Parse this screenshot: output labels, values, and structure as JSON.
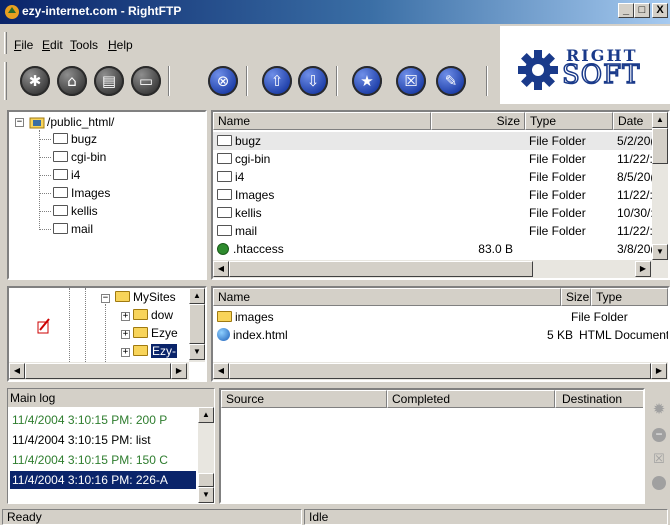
{
  "window": {
    "title": "ezy-internet.com - RightFTP",
    "min": "_",
    "max": "□",
    "close": "X"
  },
  "menu": [
    "File",
    "Edit",
    "Tools",
    "Help"
  ],
  "logo": {
    "line1": "RIGHT",
    "line2": "SOFT"
  },
  "toolbar": {
    "icons": [
      "connect-icon",
      "disconnect-icon",
      "site-manager-icon",
      "terminal-icon",
      "abort-icon",
      "upload-icon",
      "download-icon",
      "new-folder-icon",
      "properties-icon",
      "delete-icon"
    ]
  },
  "remote_tree": {
    "root": "/public_html/",
    "items": [
      "bugz",
      "cgi-bin",
      "i4",
      "Images",
      "kellis",
      "mail"
    ]
  },
  "remote_files": {
    "columns": [
      "Name",
      "Size",
      "Type",
      "Date"
    ],
    "rows": [
      {
        "name": "bugz",
        "size": "",
        "type": "File Folder",
        "date": "5/2/20("
      },
      {
        "name": "cgi-bin",
        "size": "",
        "type": "File Folder",
        "date": "11/22/:"
      },
      {
        "name": "i4",
        "size": "",
        "type": "File Folder",
        "date": "8/5/20("
      },
      {
        "name": "Images",
        "size": "",
        "type": "File Folder",
        "date": "11/22/:"
      },
      {
        "name": "kellis",
        "size": "",
        "type": "File Folder",
        "date": "10/30/:"
      },
      {
        "name": "mail",
        "size": "",
        "type": "File Folder",
        "date": "11/22/:"
      },
      {
        "name": ".htaccess",
        "size": "83.0 B",
        "type": "",
        "date": "3/8/20("
      }
    ]
  },
  "local_tree": {
    "items": [
      "MySites",
      "dow",
      "Ezye",
      "Ezy-"
    ]
  },
  "local_files": {
    "columns": [
      "Name",
      "Size",
      "Type"
    ],
    "rows": [
      {
        "name": "images",
        "size": "",
        "type": "File Folder"
      },
      {
        "name": "index.html",
        "size": "5 KB",
        "type": "HTML Document"
      }
    ]
  },
  "log": {
    "title": "Main log",
    "lines": [
      {
        "text": "11/4/2004 3:10:15 PM: 200 P",
        "color": "#2e7d2e"
      },
      {
        "text": "11/4/2004 3:10:15 PM: list",
        "color": "#000000"
      },
      {
        "text": "11/4/2004 3:10:15 PM: 150 C",
        "color": "#2e7d2e"
      },
      {
        "text": "11/4/2004 3:10:16 PM: 226-A",
        "color": "#ffffff"
      }
    ]
  },
  "queue": {
    "columns": [
      "Source",
      "Completed",
      "Destination"
    ]
  },
  "status": {
    "left": "Ready",
    "right": "Idle"
  }
}
